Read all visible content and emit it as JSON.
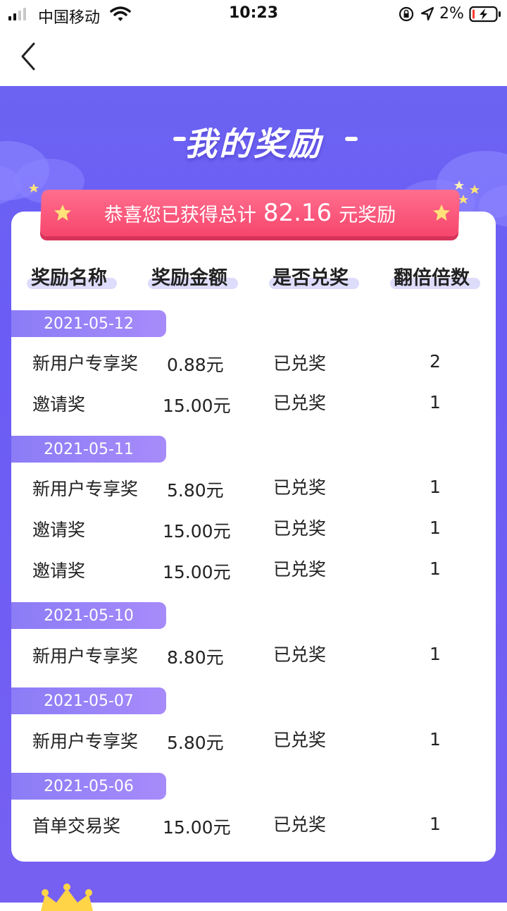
{
  "status_bar": {
    "carrier": "中国移动",
    "time": "10:23",
    "battery_percent": "2%",
    "icons": [
      "signal-icon",
      "wifi-icon",
      "orientation-lock-icon",
      "location-icon",
      "battery-icon"
    ]
  },
  "nav": {
    "back_icon": "chevron-left-icon"
  },
  "page": {
    "title": "我的奖励",
    "banner": {
      "prefix": "恭喜您已获得总计",
      "amount": "82.16",
      "suffix": "元奖励"
    },
    "columns": [
      "奖励名称",
      "奖励金额",
      "是否兑奖",
      "翻倍倍数"
    ]
  },
  "groups": [
    {
      "date": "2021-05-12",
      "rows": [
        {
          "name": "新用户专享奖",
          "amount": "0.88元",
          "status": "已兑奖",
          "multiplier": "2"
        },
        {
          "name": "邀请奖",
          "amount": "15.00元",
          "status": "已兑奖",
          "multiplier": "1"
        }
      ]
    },
    {
      "date": "2021-05-11",
      "rows": [
        {
          "name": "新用户专享奖",
          "amount": "5.80元",
          "status": "已兑奖",
          "multiplier": "1"
        },
        {
          "name": "邀请奖",
          "amount": "15.00元",
          "status": "已兑奖",
          "multiplier": "1"
        },
        {
          "name": "邀请奖",
          "amount": "15.00元",
          "status": "已兑奖",
          "multiplier": "1"
        }
      ]
    },
    {
      "date": "2021-05-10",
      "rows": [
        {
          "name": "新用户专享奖",
          "amount": "8.80元",
          "status": "已兑奖",
          "multiplier": "1"
        }
      ]
    },
    {
      "date": "2021-05-07",
      "rows": [
        {
          "name": "新用户专享奖",
          "amount": "5.80元",
          "status": "已兑奖",
          "multiplier": "1"
        }
      ]
    },
    {
      "date": "2021-05-06",
      "rows": [
        {
          "name": "首单交易奖",
          "amount": "15.00元",
          "status": "已兑奖",
          "multiplier": "1"
        }
      ]
    }
  ],
  "colors": {
    "hero_purple": "#6c63f2",
    "banner_pink": "#f7466d",
    "date_pill": "#9a84f8",
    "header_underline": "#dedcfb"
  }
}
